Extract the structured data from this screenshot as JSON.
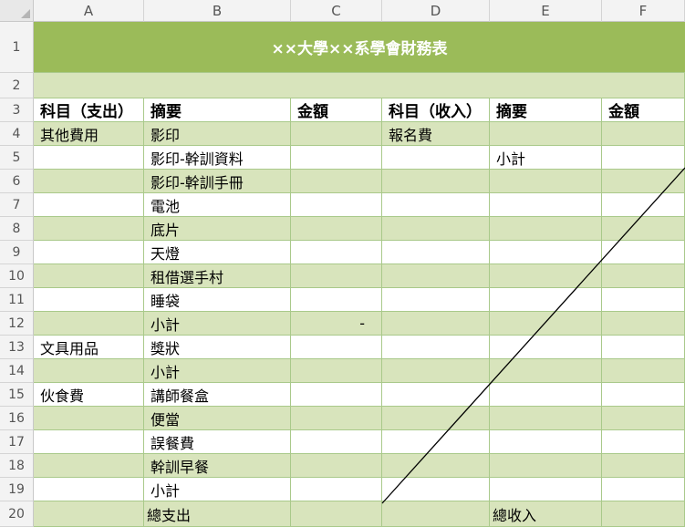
{
  "colors": {
    "band_dark": "#d8e4bc",
    "band_light": "#ffffff",
    "title_bg": "#9bbb59",
    "title_text": "#ffffff",
    "border": "#a9c98a"
  },
  "columns": [
    "A",
    "B",
    "C",
    "D",
    "E",
    "F"
  ],
  "rows": [
    "1",
    "2",
    "3",
    "4",
    "5",
    "6",
    "7",
    "8",
    "9",
    "10",
    "11",
    "12",
    "13",
    "14",
    "15",
    "16",
    "17",
    "18",
    "19",
    "20"
  ],
  "title": "××大學××系學會財務表",
  "cells": {
    "a3": "科目（支出）",
    "b3": "摘要",
    "c3": "金額",
    "d3": "科目（收入）",
    "e3": "摘要",
    "f3": "金額",
    "a4": "其他費用",
    "b4": "影印",
    "d4": "報名費",
    "b5": "影印-幹訓資料",
    "e5": "小計",
    "b6": "影印-幹訓手冊",
    "b7": "電池",
    "b8": "底片",
    "b9": "天燈",
    "b10": "租借選手村",
    "b11": "睡袋",
    "b12": "小計",
    "c12": "-",
    "a13": "文具用品",
    "b13": "獎狀",
    "b14": "小計",
    "a15": "伙食費",
    "b15": "講師餐盒",
    "b16": "便當",
    "b17": "誤餐費",
    "b18": "幹訓早餐",
    "b19": "小計",
    "b20": "總支出",
    "e20": "總收入"
  }
}
